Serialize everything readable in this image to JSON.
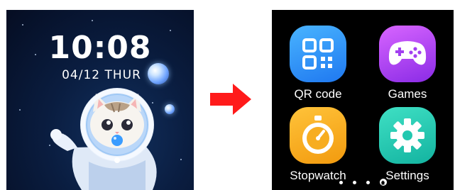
{
  "watch_face": {
    "time": "10:08",
    "date": "04/12 THUR",
    "wallpaper": "astronaut-cat-in-space"
  },
  "transition": {
    "icon": "red-arrow-right-icon",
    "color": "#ff1a1a"
  },
  "launcher": {
    "apps": [
      {
        "label": "QR code",
        "icon": "qr-code-icon",
        "color": "#2f90f5"
      },
      {
        "label": "Games",
        "icon": "gamepad-icon",
        "color": "#b040f0"
      },
      {
        "label": "Stopwatch",
        "icon": "stopwatch-icon",
        "color": "#f7ad20"
      },
      {
        "label": "Settings",
        "icon": "gear-icon",
        "color": "#22c8b0"
      }
    ],
    "pager": {
      "pages": 4,
      "current_icon": "home-icon"
    }
  }
}
